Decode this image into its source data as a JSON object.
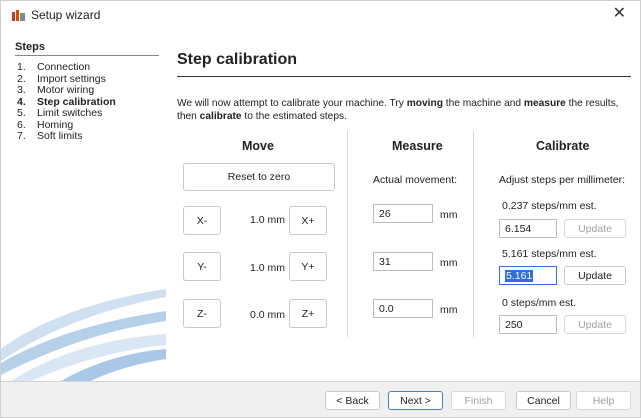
{
  "window": {
    "title": "Setup wizard",
    "close_glyph": "✕"
  },
  "sidebar": {
    "header": "Steps",
    "items": [
      {
        "num": "1.",
        "label": "Connection"
      },
      {
        "num": "2.",
        "label": "Import settings"
      },
      {
        "num": "3.",
        "label": "Motor wiring"
      },
      {
        "num": "4.",
        "label": "Step calibration"
      },
      {
        "num": "5.",
        "label": "Limit switches"
      },
      {
        "num": "6.",
        "label": "Homing"
      },
      {
        "num": "7.",
        "label": "Soft limits"
      }
    ],
    "active_index": 3
  },
  "page": {
    "title": "Step calibration",
    "intro_a": "We will now attempt to calibrate your machine. Try ",
    "intro_b": "moving",
    "intro_c": " the machine and ",
    "intro_d": "measure",
    "intro_e": " the results,",
    "intro_f": "then ",
    "intro_g": "calibrate",
    "intro_h": " to the estimated steps."
  },
  "move": {
    "header": "Move",
    "reset_label": "Reset to zero",
    "axes": [
      {
        "minus": "X-",
        "plus": "X+",
        "distance": "1.0 mm"
      },
      {
        "minus": "Y-",
        "plus": "Y+",
        "distance": "1.0 mm"
      },
      {
        "minus": "Z-",
        "plus": "Z+",
        "distance": "0.0 mm"
      }
    ]
  },
  "measure": {
    "header": "Measure",
    "label": "Actual movement:",
    "unit": "mm",
    "values": [
      "26",
      "31",
      "0.0"
    ]
  },
  "calibrate": {
    "header": "Calibrate",
    "label": "Adjust steps per millimeter:",
    "update_label": "Update",
    "rows": [
      {
        "estimate": "0.237 steps/mm est.",
        "value": "6.154"
      },
      {
        "estimate": "5.161 steps/mm est.",
        "value": "5.161"
      },
      {
        "estimate": "0 steps/mm est.",
        "value": "250"
      }
    ]
  },
  "footer": {
    "back": "< Back",
    "next": "Next >",
    "finish": "Finish",
    "cancel": "Cancel",
    "help": "Help"
  },
  "colors": {
    "accent": "#2f6fd6",
    "swoosh": "#a9c7e6"
  }
}
